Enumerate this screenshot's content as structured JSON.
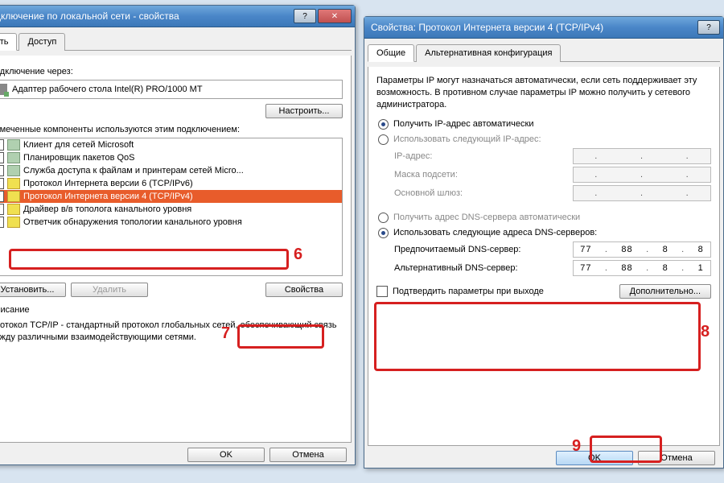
{
  "w1": {
    "title": "Подключение по локальной сети - свойства",
    "tabs": [
      "Сеть",
      "Доступ"
    ],
    "connect_via": "Подключение через:",
    "adapter": "Адаптер рабочего стола Intel(R) PRO/1000 MT",
    "configure": "Настроить...",
    "components_uses": "Отмеченные компоненты используются этим подключением:",
    "items": [
      "Клиент для сетей Microsoft",
      "Планировщик пакетов QoS",
      "Служба доступа к файлам и принтерам сетей Micro...",
      "Протокол Интернета версии 6 (TCP/IPv6)",
      "Протокол Интернета версии 4 (TCP/IPv4)",
      "Драйвер в/в тополога канального уровня",
      "Ответчик обнаружения топологии канального уровня"
    ],
    "install": "Установить...",
    "remove": "Удалить",
    "properties": "Свойства",
    "desc_head": "Описание",
    "desc_body": "Протокол TCP/IP - стандартный протокол глобальных сетей, обеспечивающий связь между различными взаимодействующими сетями.",
    "ok": "OK",
    "cancel": "Отмена"
  },
  "w2": {
    "title": "Свойства: Протокол Интернета версии 4 (TCP/IPv4)",
    "tabs": [
      "Общие",
      "Альтернативная конфигурация"
    ],
    "blurb": "Параметры IP могут назначаться автоматически, если сеть поддерживает эту возможность. В противном случае параметры IP можно получить у сетевого администратора.",
    "ip_auto": "Получить IP-адрес автоматически",
    "ip_manual": "Использовать следующий IP-адрес:",
    "ip_addr": "IP-адрес:",
    "ip_mask": "Маска подсети:",
    "ip_gw": "Основной шлюз:",
    "dns_auto": "Получить адрес DNS-сервера автоматически",
    "dns_manual": "Использовать следующие адреса DNS-серверов:",
    "dns_pref": "Предпочитаемый DNS-сервер:",
    "dns_alt": "Альтернативный DNS-сервер:",
    "dns1": [
      "77",
      "88",
      "8",
      "8"
    ],
    "dns2": [
      "77",
      "88",
      "8",
      "1"
    ],
    "validate": "Подтвердить параметры при выходе",
    "advanced": "Дополнительно...",
    "ok": "OK",
    "cancel": "Отмена"
  },
  "marks": {
    "m6": "6",
    "m7": "7",
    "m8": "8",
    "m9": "9"
  }
}
